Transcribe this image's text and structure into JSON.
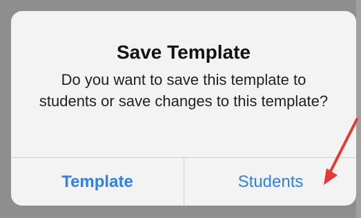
{
  "dialog": {
    "title": "Save Template",
    "message": "Do you want to save this template to students or save changes to this template?",
    "buttons": {
      "template": "Template",
      "students": "Students"
    }
  },
  "colors": {
    "background": "#8e8e8e",
    "dialog_background": "#f3f3f3",
    "button_text": "#2f80ed",
    "arrow": "#e53935",
    "divider": "#cfcfcf"
  },
  "icons": {
    "annotation": "red-arrow-icon"
  }
}
